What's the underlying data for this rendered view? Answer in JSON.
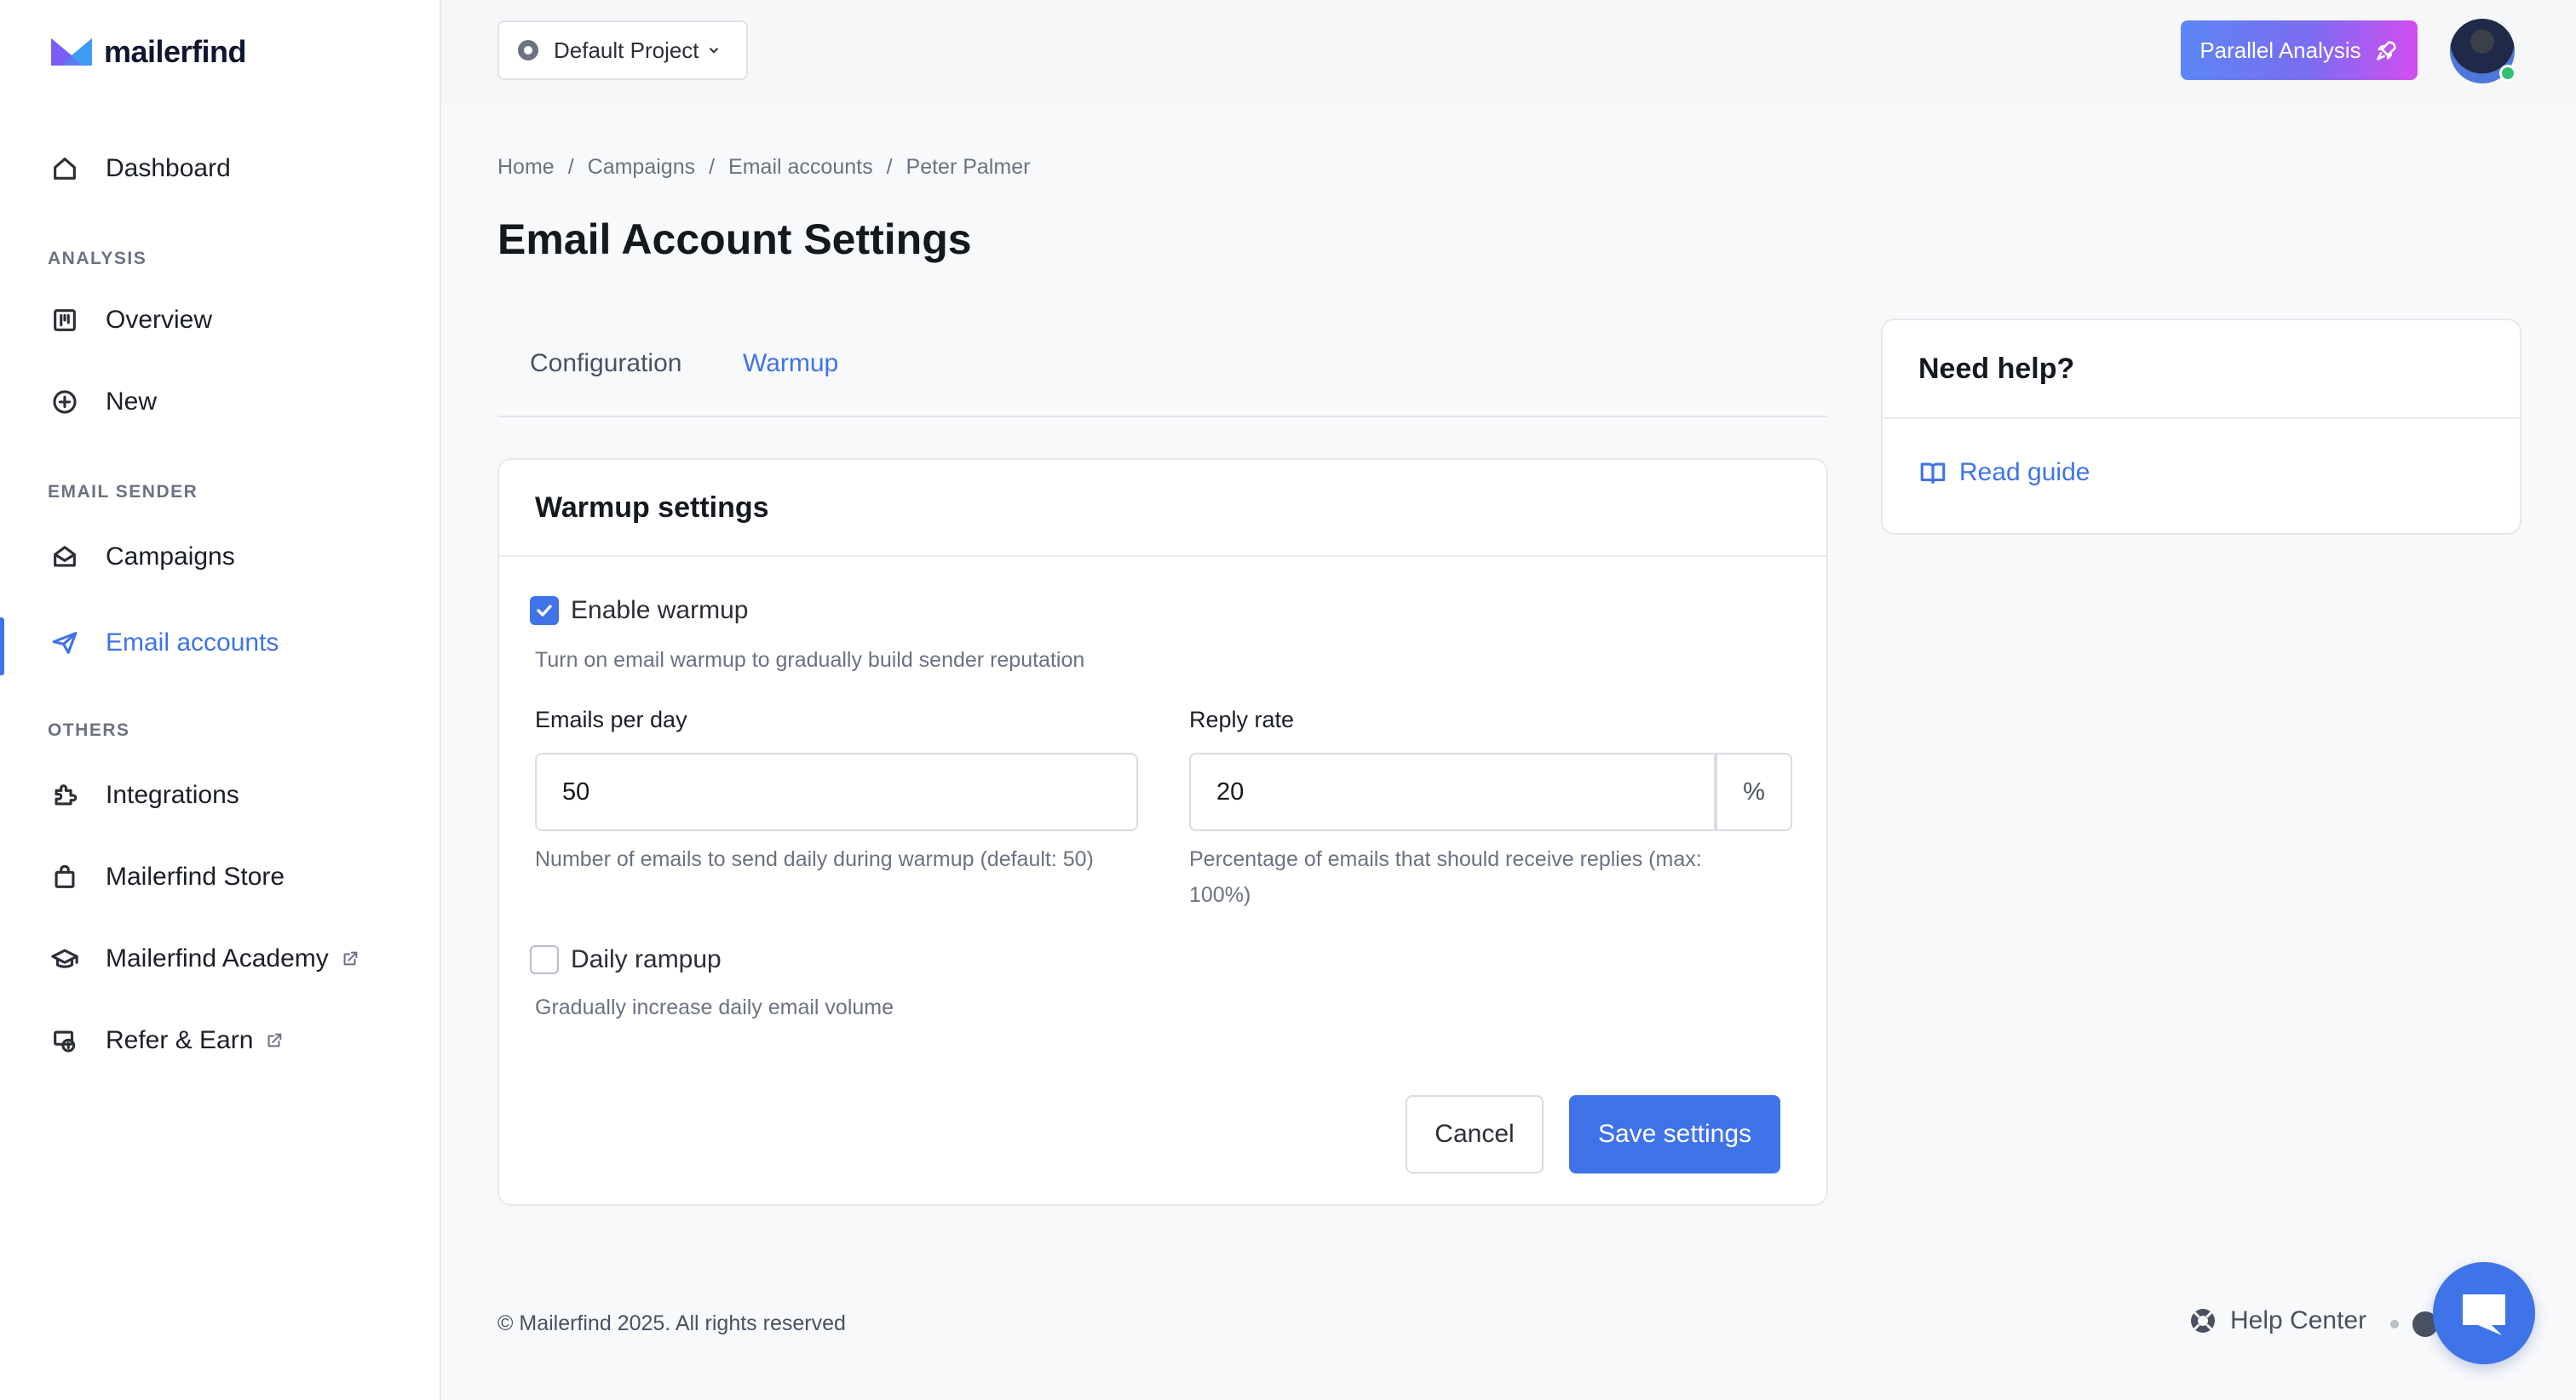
{
  "brand": {
    "name": "mailerfind",
    "accent": "#3f73e8"
  },
  "sidebar": {
    "items": [
      {
        "label": "Dashboard",
        "icon": "home-icon"
      },
      {
        "label": "Overview",
        "icon": "kanban-icon"
      },
      {
        "label": "New",
        "icon": "plus-circle-icon"
      },
      {
        "label": "Campaigns",
        "icon": "envelope-open-icon"
      },
      {
        "label": "Email accounts",
        "icon": "send-icon",
        "active": true
      },
      {
        "label": "Integrations",
        "icon": "puzzle-icon"
      },
      {
        "label": "Mailerfind Store",
        "icon": "shopping-bag-icon"
      },
      {
        "label": "Mailerfind Academy",
        "icon": "graduation-cap-icon",
        "external": true
      },
      {
        "label": "Refer & Earn",
        "icon": "money-hand-icon",
        "external": true
      }
    ],
    "sections": [
      "ANALYSIS",
      "EMAIL SENDER",
      "OTHERS"
    ]
  },
  "topbar": {
    "project": "Default Project",
    "parallel_analysis": "Parallel Analysis"
  },
  "breadcrumb": [
    "Home",
    "Campaigns",
    "Email accounts",
    "Peter Palmer"
  ],
  "page_title": "Email Account Settings",
  "tabs": [
    {
      "label": "Configuration"
    },
    {
      "label": "Warmup",
      "active": true
    }
  ],
  "warmup": {
    "title": "Warmup settings",
    "enable_label": "Enable warmup",
    "enable_checked": true,
    "enable_hint": "Turn on email warmup to gradually build sender reputation",
    "emails_per_day_label": "Emails per day",
    "emails_per_day_value": "50",
    "emails_per_day_hint": "Number of emails to send daily during warmup (default: 50)",
    "reply_rate_label": "Reply rate",
    "reply_rate_value": "20",
    "reply_rate_unit": "%",
    "reply_rate_hint_1": "Percentage of emails that should receive replies (max:",
    "reply_rate_hint_2": "100%)",
    "rampup_label": "Daily rampup",
    "rampup_checked": false,
    "rampup_hint": "Gradually increase daily email volume",
    "cancel": "Cancel",
    "save": "Save settings"
  },
  "help": {
    "title": "Need help?",
    "guide": "Read guide"
  },
  "footer": {
    "copyright": "© Mailerfind 2025. All rights reserved",
    "help_center": "Help Center"
  }
}
